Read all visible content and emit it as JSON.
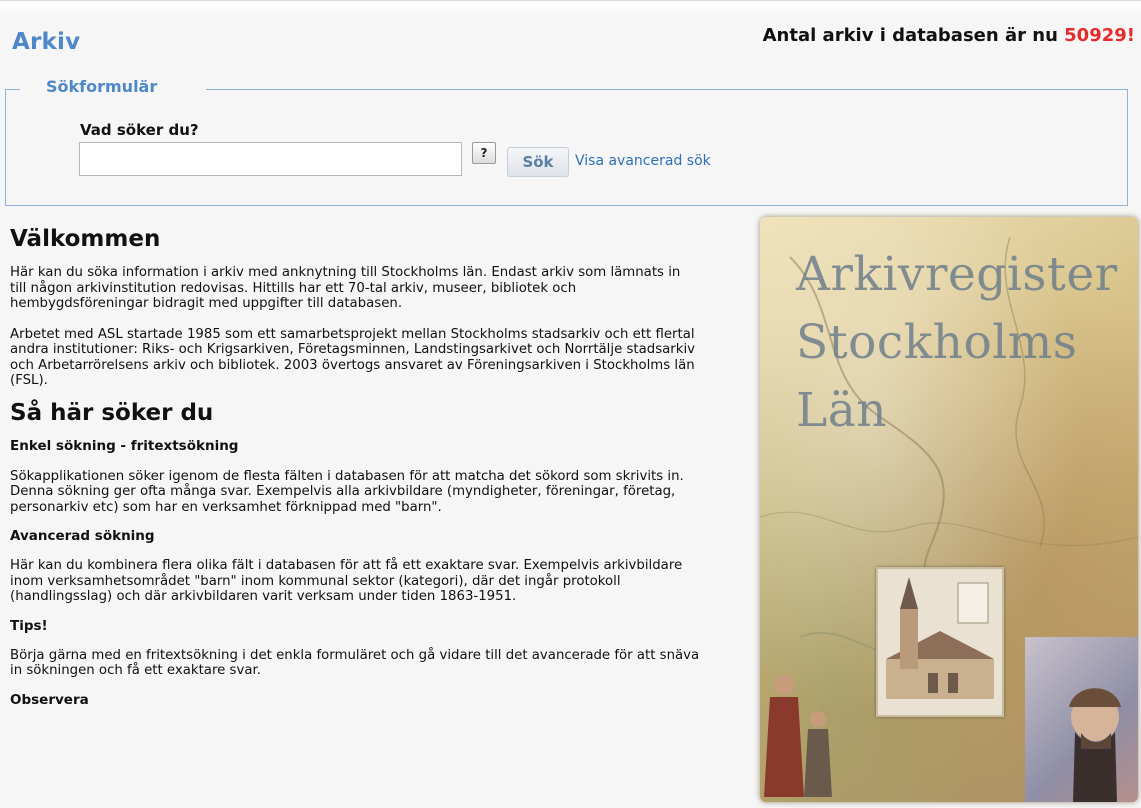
{
  "header": {
    "title": "Arkiv",
    "count_text": "Antal arkiv i databasen är nu ",
    "count_value": "50929!"
  },
  "search": {
    "legend": "Sökformulär",
    "label": "Vad söker du?",
    "value": "",
    "placeholder": "",
    "help_label": "?",
    "submit_label": "Sök",
    "advanced_link": "Visa avancerad sök"
  },
  "content": {
    "welcome_heading": "Välkommen",
    "welcome_p1": "Här kan du söka information i arkiv med anknytning till Stockholms län. Endast arkiv som lämnats in till någon arkivinstitution redovisas. Hittills har ett 70-tal arkiv, museer, bibliotek och hembygdsföreningar bidragit med uppgifter till databasen.",
    "welcome_p2": "Arbetet med ASL startade 1985 som ett samarbetsprojekt mellan Stockholms stadsarkiv och ett flertal andra institutioner: Riks- och Krigsarkiven, Företagsminnen, Landstingsarkivet och Norrtälje stadsarkiv och Arbetarrörelsens arkiv och bibliotek. 2003 övertogs ansvaret av Föreningsarkiven i Stockholms län (FSL).",
    "howto_heading": "Så här söker du",
    "simple_heading": "Enkel sökning - fritextsökning",
    "simple_text": "Sökapplikationen söker igenom de flesta fälten i databasen för att matcha det sökord som skrivits in. Denna sökning ger ofta många svar. Exempelvis alla arkivbildare (myndigheter, föreningar, företag, personarkiv etc) som har en verksamhet förknippad med \"barn\".",
    "advanced_heading": "Avancerad sökning",
    "advanced_text": "Här kan du kombinera flera olika fält i databasen för att få ett exaktare svar. Exempelvis arkivbildare inom verksamhetsområdet \"barn\" inom kommunal sektor (kategori), där det ingår protokoll (handlingsslag) och där arkivbildaren varit verksam under tiden 1863-1951.",
    "tips_heading": "Tips!",
    "tips_text": "Börja gärna med en fritextsökning i det enkla formuläret och gå vidare till det avancerade för att snäva in sökningen och få ett exaktare svar.",
    "observe_heading": "Observera"
  },
  "image": {
    "title_line1": "Arkivregister",
    "title_line2": "Stockholms",
    "title_line3": "Län"
  },
  "colors": {
    "accent": "#4e88c7",
    "count": "#e52b2b",
    "link": "#2f6fb5",
    "border": "#8fb3d9"
  }
}
